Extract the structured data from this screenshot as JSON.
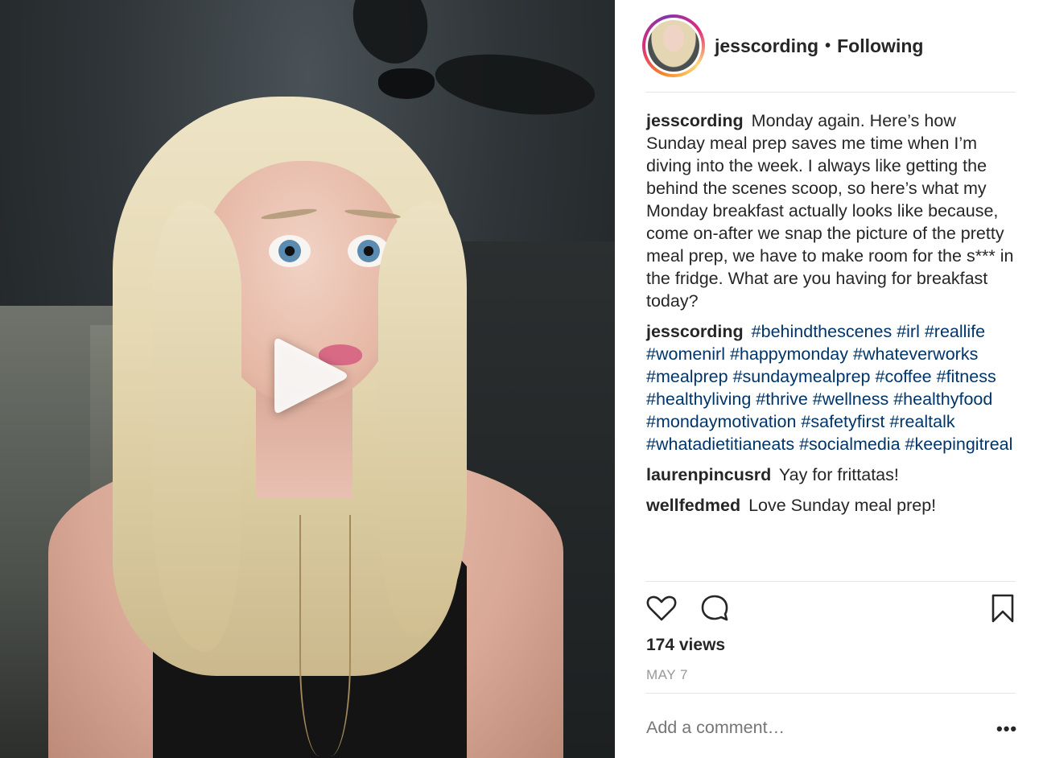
{
  "post": {
    "username": "jesscording",
    "follow_status": "Following",
    "separator": "•"
  },
  "media": {
    "type": "video",
    "play_icon": "play-icon"
  },
  "caption": {
    "username": "jesscording",
    "text": "Monday again. Here’s how Sunday meal prep saves me time when I’m diving into the week. I always like getting the behind the scenes scoop, so here’s what my Monday breakfast actually looks like because, come on-after we snap the picture of the pretty meal prep, we have to make room for the s*** in the fridge. What are you having for breakfast today?"
  },
  "hashtag_comment": {
    "username": "jesscording",
    "tags": [
      "#behindthescenes",
      "#irl",
      "#reallife",
      "#womenirl",
      "#happymonday",
      "#whateverworks",
      "#mealprep",
      "#sundaymealprep",
      "#coffee",
      "#fitness",
      "#healthyliving",
      "#thrive",
      "#wellness",
      "#healthyfood",
      "#mondaymotivation",
      "#safetyfirst",
      "#realtalk",
      "#whatadietitianeats",
      "#socialmedia",
      "#keepingitreal"
    ]
  },
  "comments": [
    {
      "username": "laurenpincusrd",
      "text": "Yay for frittatas!"
    },
    {
      "username": "wellfedmed",
      "text": "Love Sunday meal prep!"
    }
  ],
  "actions": {
    "like_icon": "heart-icon",
    "comment_icon": "speech-bubble-icon",
    "save_icon": "bookmark-icon"
  },
  "stats": {
    "views": "174 views",
    "date": "MAY 7"
  },
  "add_comment": {
    "placeholder": "Add a comment…",
    "more_label": "•••"
  },
  "colors": {
    "text": "#262626",
    "hashtag": "#003569",
    "muted": "#999999",
    "divider": "#e6e6e6"
  }
}
